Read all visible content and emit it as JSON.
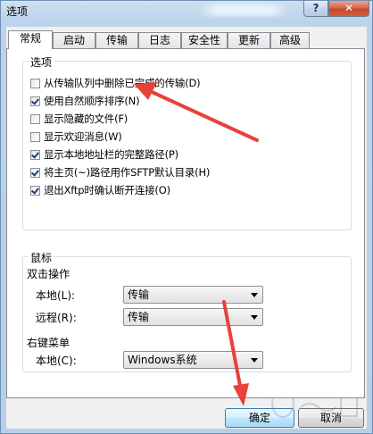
{
  "window": {
    "title": "选项",
    "help_label": "?",
    "close_label": "✕"
  },
  "tabs": [
    {
      "label": "常规",
      "active": true
    },
    {
      "label": "启动"
    },
    {
      "label": "传输"
    },
    {
      "label": "日志"
    },
    {
      "label": "安全性"
    },
    {
      "label": "更新"
    },
    {
      "label": "高级"
    }
  ],
  "options": {
    "group_label": "选项",
    "items": [
      {
        "label": "从传输队列中删除已完成的传输(D)",
        "checked": false
      },
      {
        "label": "使用自然顺序排序(N)",
        "checked": true
      },
      {
        "label": "显示隐藏的文件(F)",
        "checked": false
      },
      {
        "label": "显示欢迎消息(W)",
        "checked": false
      },
      {
        "label": "显示本地地址栏的完整路径(P)",
        "checked": true
      },
      {
        "label": "将主页(~)路径用作SFTP默认目录(H)",
        "checked": true
      },
      {
        "label": "退出Xftp时确认断开连接(O)",
        "checked": true
      }
    ]
  },
  "mouse": {
    "group_label": "鼠标",
    "double_click_label": "双击操作",
    "local_label": "本地(L):",
    "local_value": "传输",
    "remote_label": "远程(R):",
    "remote_value": "传输",
    "context_menu_label": "右键菜单",
    "context_local_label": "本地(C):",
    "context_local_value": "Windows系统"
  },
  "buttons": {
    "ok": "确定",
    "cancel": "取消"
  },
  "colors": {
    "annotation_arrow": "#e8413a",
    "close_button": "#c9462c"
  }
}
